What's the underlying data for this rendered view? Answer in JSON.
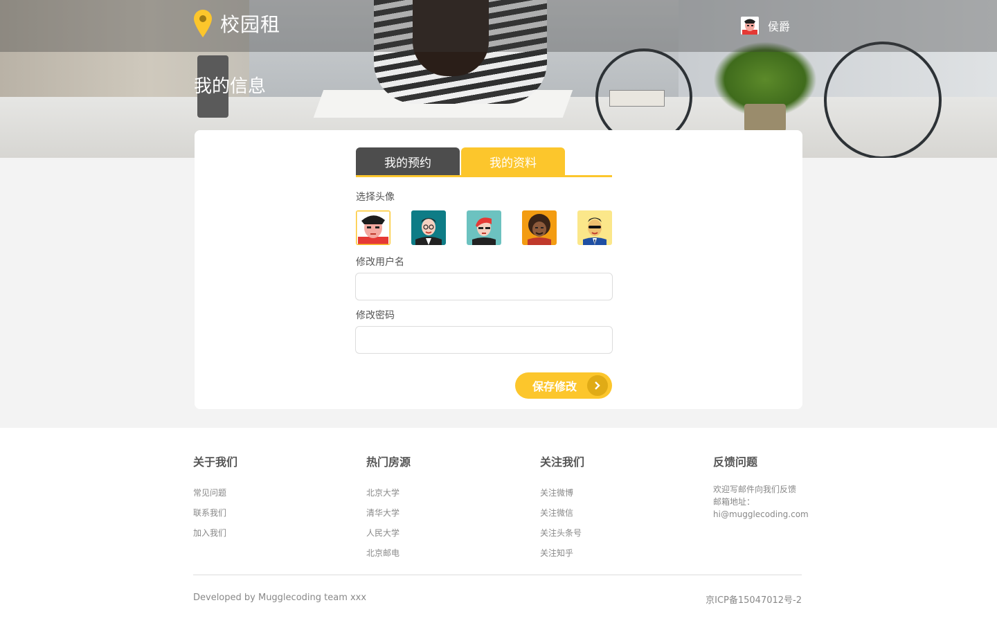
{
  "header": {
    "app_name": "校园租",
    "user_name": "侯爵",
    "page_title": "我的信息"
  },
  "tabs": [
    {
      "label": "我的预约",
      "active": false
    },
    {
      "label": "我的资料",
      "active": true
    }
  ],
  "profile_form": {
    "avatar_label": "选择头像",
    "avatars": [
      {
        "name": "avatar-1",
        "selected": true
      },
      {
        "name": "avatar-2",
        "selected": false
      },
      {
        "name": "avatar-3",
        "selected": false
      },
      {
        "name": "avatar-4",
        "selected": false
      },
      {
        "name": "avatar-5",
        "selected": false
      }
    ],
    "username_label": "修改用户名",
    "username_value": "",
    "password_label": "修改密码",
    "password_value": "",
    "save_label": "保存修改"
  },
  "footer": {
    "columns": [
      {
        "title": "关于我们",
        "items": [
          "常见问题",
          "联系我们",
          "加入我们"
        ]
      },
      {
        "title": "热门房源",
        "items": [
          "北京大学",
          "清华大学",
          "人民大学",
          "北京邮电"
        ]
      },
      {
        "title": "关注我们",
        "items": [
          "关注微博",
          "关注微信",
          "关注头条号",
          "关注知乎"
        ]
      },
      {
        "title": "反馈问题",
        "lines": [
          "欢迎写邮件向我们反馈",
          "邮箱地址：",
          "hi@mugglecoding.com"
        ]
      }
    ],
    "credit": "Developed by Mugglecoding team xxx",
    "icp": "京ICP备15047012号-2"
  },
  "colors": {
    "accent": "#fcc62c",
    "tab_dark": "#4d4d4d",
    "page_bg": "#f3f3f3"
  },
  "icons": [
    "location-pin-icon",
    "chevron-right-icon"
  ]
}
